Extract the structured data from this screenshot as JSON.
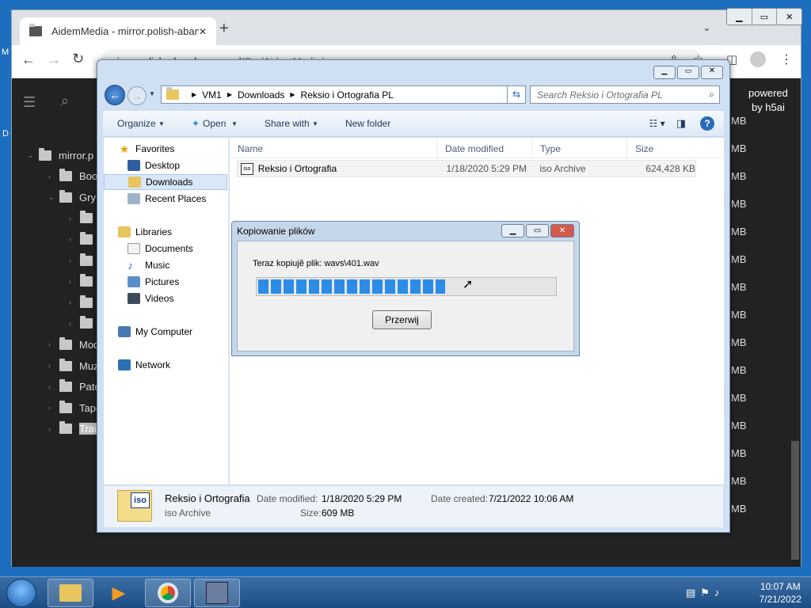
{
  "desktop": {
    "left_label_1": "M",
    "left_label_2": "D"
  },
  "browser": {
    "tab_title": "AidemMedia - mirror.polish-abandonware.pl",
    "new_tab": "+",
    "url_host": "mirror.polish-abandonware.pl",
    "url_path": "/Gry/AidemMedia/",
    "powered_1": "powered",
    "powered_2": "by h5ai",
    "tree": [
      {
        "label": "mirror.p",
        "indent": 0,
        "expanded": true
      },
      {
        "label": "Boo",
        "indent": 1
      },
      {
        "label": "Gry",
        "indent": 1,
        "expanded": true
      },
      {
        "label": "A",
        "indent": 2
      },
      {
        "label": "D",
        "indent": 2
      },
      {
        "label": "D",
        "indent": 2
      },
      {
        "label": "F",
        "indent": 2
      },
      {
        "label": "K",
        "indent": 2
      },
      {
        "label": "S",
        "indent": 2
      },
      {
        "label": "Mod",
        "indent": 1
      },
      {
        "label": "Muz",
        "indent": 1
      },
      {
        "label": "Patc",
        "indent": 1
      },
      {
        "label": "Tape",
        "indent": 1
      },
      {
        "label": "Trail",
        "indent": 1,
        "selected": true
      }
    ],
    "size_unit": "MB"
  },
  "explorer": {
    "breadcrumb": [
      "VM1",
      "Downloads",
      "Reksio i Ortografia PL"
    ],
    "search_placeholder": "Search Reksio i Ortografia PL",
    "cmd": {
      "organize": "Organize",
      "open": "Open",
      "share": "Share with",
      "newfolder": "New folder"
    },
    "nav": {
      "favorites": "Favorites",
      "desktop": "Desktop",
      "downloads": "Downloads",
      "recent": "Recent Places",
      "libraries": "Libraries",
      "documents": "Documents",
      "music": "Music",
      "pictures": "Pictures",
      "videos": "Videos",
      "computer": "My Computer",
      "network": "Network"
    },
    "columns": {
      "name": "Name",
      "date": "Date modified",
      "type": "Type",
      "size": "Size"
    },
    "file": {
      "name": "Reksio i Ortografia",
      "date": "1/18/2020 5:29 PM",
      "type": "iso Archive",
      "size": "624,428 KB",
      "icon_text": "iso"
    },
    "details": {
      "name": "Reksio i Ortografia",
      "type": "iso Archive",
      "date_mod_label": "Date modified:",
      "date_mod": "1/18/2020 5:29 PM",
      "size_label": "Size:",
      "size": "609 MB",
      "created_label": "Date created:",
      "created": "7/21/2022 10:06 AM"
    }
  },
  "dialog": {
    "title": "Kopiowanie plików",
    "status": "Teraz kopiujê plik: wavs\\401.wav",
    "progress": 0.63,
    "cancel": "Przerwij"
  },
  "taskbar": {
    "time": "10:07 AM",
    "date": "7/21/2022"
  }
}
